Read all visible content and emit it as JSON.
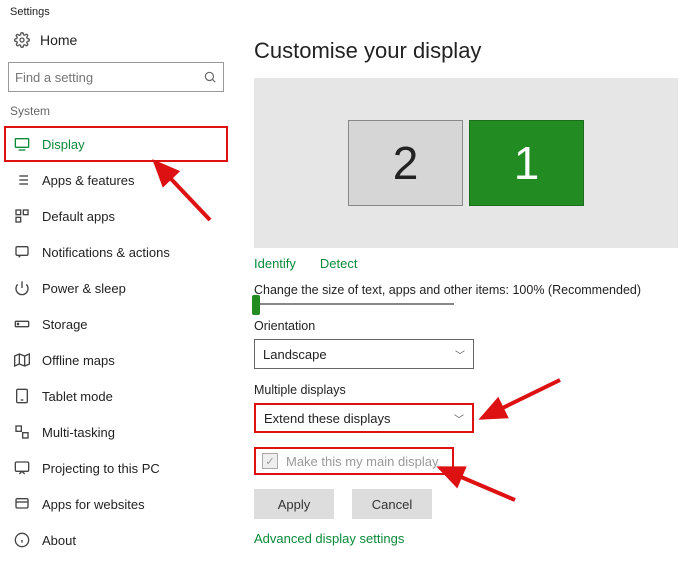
{
  "app_title": "Settings",
  "sidebar": {
    "home_label": "Home",
    "search_placeholder": "Find a setting",
    "section_label": "System",
    "items": [
      {
        "label": "Display"
      },
      {
        "label": "Apps & features"
      },
      {
        "label": "Default apps"
      },
      {
        "label": "Notifications & actions"
      },
      {
        "label": "Power & sleep"
      },
      {
        "label": "Storage"
      },
      {
        "label": "Offline maps"
      },
      {
        "label": "Tablet mode"
      },
      {
        "label": "Multi-tasking"
      },
      {
        "label": "Projecting to this PC"
      },
      {
        "label": "Apps for websites"
      },
      {
        "label": "About"
      }
    ]
  },
  "main": {
    "heading": "Customise your display",
    "monitors": {
      "secondary": "2",
      "primary": "1"
    },
    "identify": "Identify",
    "detect": "Detect",
    "scale_label": "Change the size of text, apps and other items: 100% (Recommended)",
    "orientation_label": "Orientation",
    "orientation_value": "Landscape",
    "multi_label": "Multiple displays",
    "multi_value": "Extend these displays",
    "main_display_label": "Make this my main display",
    "apply": "Apply",
    "cancel": "Cancel",
    "advanced": "Advanced display settings"
  }
}
